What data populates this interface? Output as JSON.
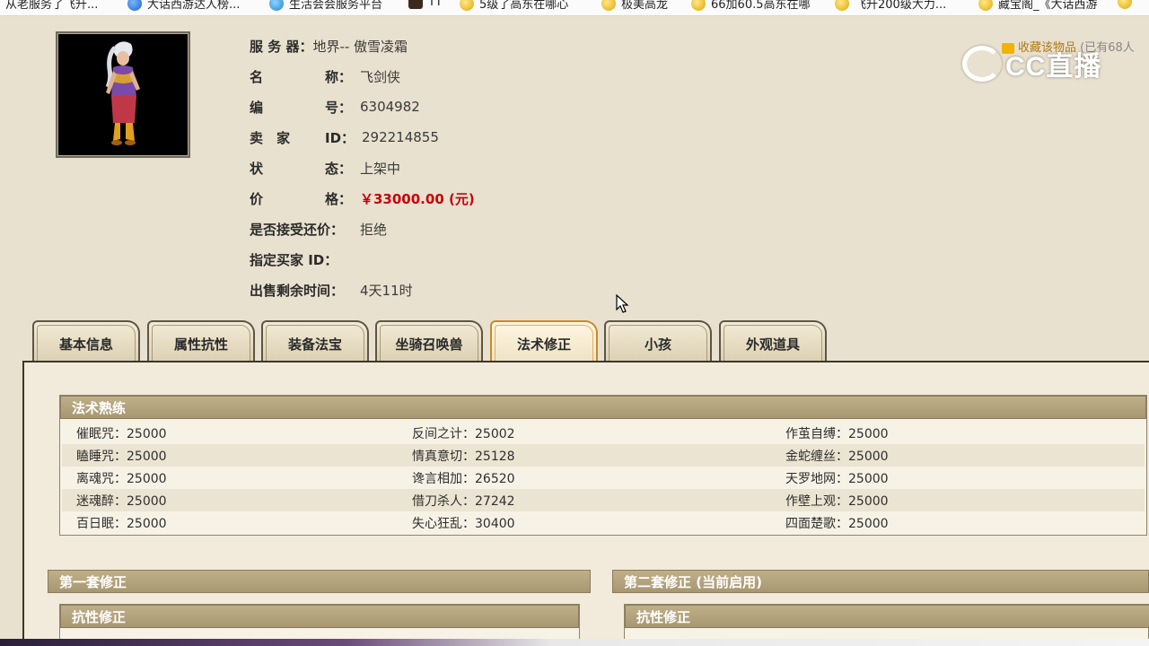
{
  "bookmarks": [
    {
      "label": "从老服务了飞升...",
      "icon": "document-icon"
    },
    {
      "label": "大话西游达人榜...",
      "icon": "globe-icon"
    },
    {
      "label": "生活会会服务平台",
      "icon": "globe-icon"
    },
    {
      "label": "TT",
      "icon": "game-icon"
    },
    {
      "label": "5级了高东在哪心",
      "icon": "star-icon"
    },
    {
      "label": "极美高龙",
      "icon": "star-icon"
    },
    {
      "label": "66加60.5高东在哪",
      "icon": "star-icon"
    },
    {
      "label": "飞升200级大力...",
      "icon": "star-icon"
    },
    {
      "label": "藏宝阁_《大话西游",
      "icon": "star-icon"
    }
  ],
  "brand": {
    "logo_text": "CC直播",
    "favorite_label": "收藏该物品",
    "favorite_count": "(已有68人"
  },
  "info": {
    "server_label": "服 务 器：",
    "server": "地界-- 傲雪凌霜",
    "name_label_a": "名",
    "name_label_b": "称：",
    "name": "飞剑侠",
    "id_label_a": "编",
    "id_label_b": "号：",
    "id": "6304982",
    "seller_label_a": "卖　家",
    "seller_label_b": "ID：",
    "seller_id": "292214855",
    "status_label_a": "状",
    "status_label_b": "态：",
    "status": "上架中",
    "price_label_a": "价",
    "price_label_b": "格：",
    "price": "￥33000.00 (元)",
    "bargain_label": "是否接受还价：",
    "bargain": "拒绝",
    "buyer_label": "指定买家 ID：",
    "buyer": "",
    "time_label": "出售剩余时间：",
    "time_left": "4天11时"
  },
  "tabs": [
    "基本信息",
    "属性抗性",
    "装备法宝",
    "坐骑召唤兽",
    "法术修正",
    "小孩",
    "外观道具"
  ],
  "active_tab": "法术修正",
  "skills": {
    "title": "法术熟练",
    "rows": [
      [
        "催眠咒：25000",
        "反间之计：25002",
        "作茧自缚：25000"
      ],
      [
        "瞌睡咒：25000",
        "情真意切：25128",
        "金蛇缠丝：25000"
      ],
      [
        "离魂咒：25000",
        "谗言相加：26520",
        "天罗地网：25000"
      ],
      [
        "迷魂醉：25000",
        "借刀杀人：27242",
        "作壁上观：25000"
      ],
      [
        "百日眠：25000",
        "失心狂乱：30400",
        "四面楚歌：25000"
      ]
    ]
  },
  "set1": {
    "title": "第一套修正",
    "sub_title": "抗性修正"
  },
  "set2": {
    "title": "第二套修正 (当前启用)",
    "sub_title": "抗性修正"
  },
  "colors": {
    "background": "#e9e1cf",
    "price": "#c8000a",
    "section_header": "#a89872",
    "active_tab_border": "#c88a2a"
  }
}
